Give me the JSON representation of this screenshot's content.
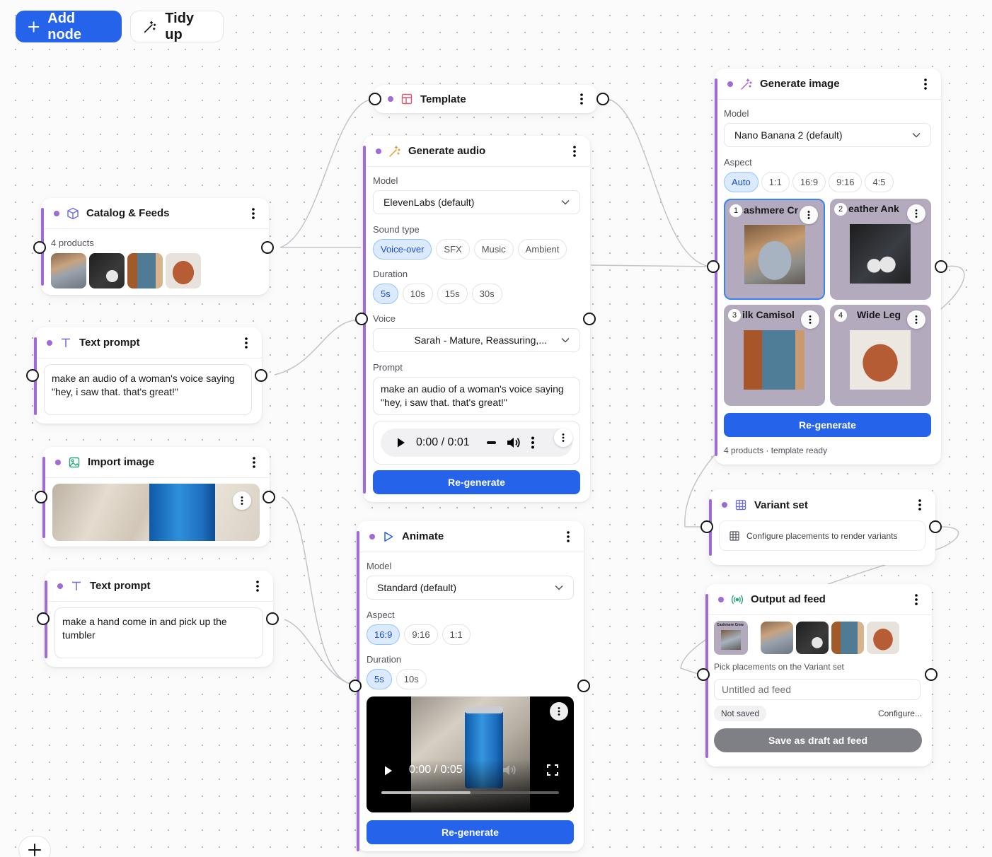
{
  "toolbar": {
    "add_node": "Add node",
    "tidy_up": "Tidy up"
  },
  "catalog": {
    "title": "Catalog & Feeds",
    "count": "4 products"
  },
  "text_prompt_1": {
    "title": "Text prompt",
    "text": "make an audio of a woman's voice saying \"hey, i saw that. that's great!\""
  },
  "import_image": {
    "title": "Import image"
  },
  "text_prompt_2": {
    "title": "Text prompt",
    "text": "make a hand come in and pick up the tumbler"
  },
  "template": {
    "title": "Template"
  },
  "generate_audio": {
    "title": "Generate audio",
    "model_label": "Model",
    "model": "ElevenLabs (default)",
    "sound_label": "Sound type",
    "sound_types": [
      "Voice-over",
      "SFX",
      "Music",
      "Ambient"
    ],
    "duration_label": "Duration",
    "durations": [
      "5s",
      "10s",
      "15s",
      "30s"
    ],
    "voice_label": "Voice",
    "voice": "Sarah - Mature, Reassuring,...",
    "prompt_label": "Prompt",
    "prompt": "make an audio of a woman's voice saying \"hey, i saw that. that's great!\"",
    "time": "0:00 / 0:01",
    "regenerate": "Re-generate"
  },
  "animate": {
    "title": "Animate",
    "model_label": "Model",
    "model": "Standard (default)",
    "aspect_label": "Aspect",
    "aspects": [
      "16:9",
      "9:16",
      "1:1"
    ],
    "duration_label": "Duration",
    "durations": [
      "5s",
      "10s"
    ],
    "time": "0:00 / 0:05",
    "progress": 0.5,
    "regenerate": "Re-generate"
  },
  "generate_image": {
    "title": "Generate image",
    "model_label": "Model",
    "model": "Nano Banana 2 (default)",
    "aspect_label": "Aspect",
    "aspects": [
      "Auto",
      "1:1",
      "16:9",
      "9:16",
      "4:5"
    ],
    "tiles": [
      {
        "n": "1",
        "name": "ashmere Cr"
      },
      {
        "n": "2",
        "name": "eather Ank"
      },
      {
        "n": "3",
        "name": "ilk Camisol"
      },
      {
        "n": "4",
        "name": "Wide Leg"
      }
    ],
    "regenerate": "Re-generate",
    "status": "4 products · template ready"
  },
  "variant_set": {
    "title": "Variant set",
    "hint": "Configure placements to render variants"
  },
  "output_feed": {
    "title": "Output ad feed",
    "hint": "Pick placements on the Variant set",
    "name_placeholder": "Untitled ad feed",
    "status": "Not saved",
    "configure": "Configure...",
    "save": "Save as draft ad feed",
    "thumb_caption": "Cashmere Crew"
  },
  "colors": {
    "accent": "#2563eb",
    "node_bar": "#9f6bd6",
    "selected_chip_bg": "#dbeafe"
  }
}
